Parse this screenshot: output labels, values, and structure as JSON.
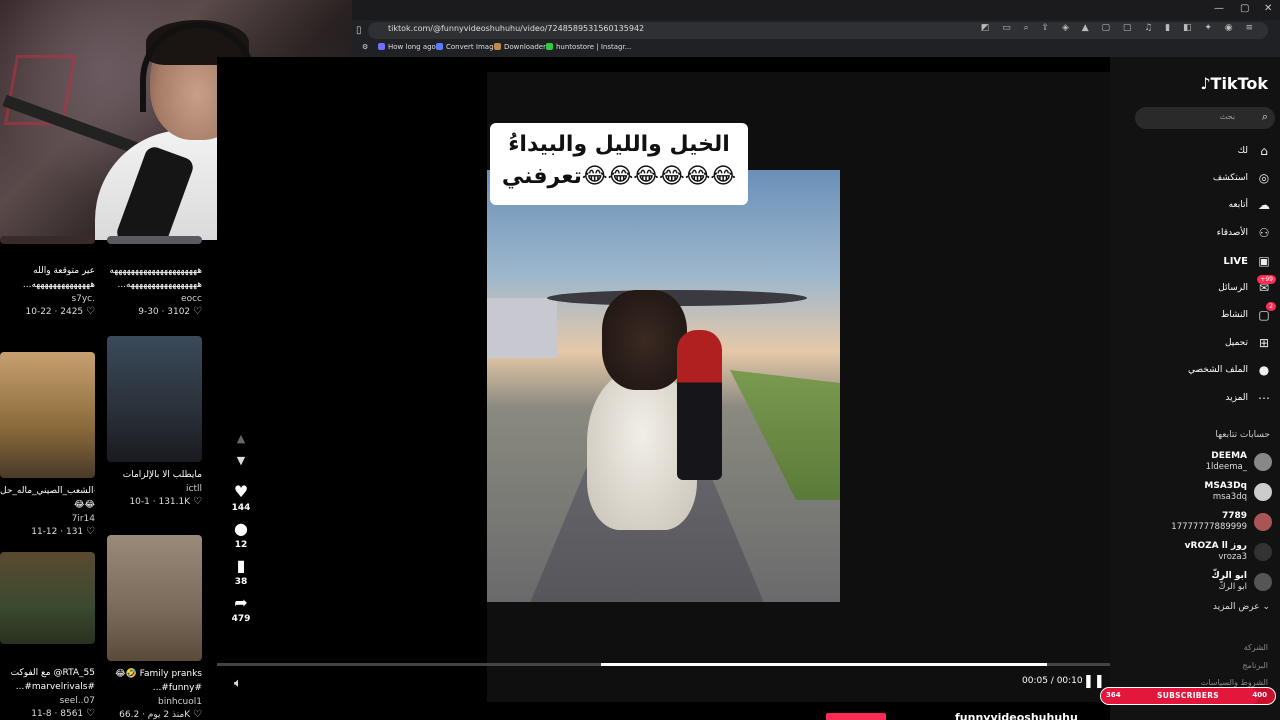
{
  "browser": {
    "url": "tiktok.com/@funnyvideoshuhuhu/video/7248589531560135942",
    "bookmarks": [
      {
        "label": "How long ago",
        "color": "#6f6fff"
      },
      {
        "label": "Convert Image",
        "color": "#5a7dff"
      },
      {
        "label": "Downloader",
        "color": "#c08a4a"
      },
      {
        "label": "huntostore | Instagr...",
        "color": "#2ecc40"
      }
    ],
    "window_controls": [
      "—",
      "▢",
      "✕"
    ]
  },
  "left_feed": {
    "cards": [
      {
        "caption": "عير متوقعة والله",
        "caption2": "...ههههههههههههههه",
        "user": "s7yc.",
        "likes": "2425",
        "date": "10-22",
        "thumb": "#3a2a2a"
      },
      {
        "caption": "هههههههههههههههههههههه",
        "caption2": "...هههههههههههههههههه",
        "user": "eocc",
        "likes": "3102",
        "date": "9-30",
        "thumb": "#5a5a60"
      },
      {
        "caption": "الشعب_الصيني_ماله_حل#",
        "caption2": "😂😂",
        "user": "7ir14",
        "likes": "131",
        "date": "11-12",
        "thumb": "#8a6a3a"
      },
      {
        "caption": "مايطلب الا بالإلزامات",
        "caption2": "",
        "user": "ictll",
        "likes": "131.1K",
        "date": "10-1",
        "thumb": "#4a5a6a"
      },
      {
        "caption": "مع الفوكت @RTA_55",
        "caption2": "...#marvelrivals#",
        "user": "seel..07",
        "likes": "8561",
        "date": "11-8",
        "thumb": "#3a4a30"
      },
      {
        "caption": "😂🤣 Family pranks",
        "caption2": "...#funny#",
        "user": "binhcuol1",
        "likes": "66.2K",
        "date": "منذ 2 يوم",
        "thumb": "#7a6a5a"
      }
    ]
  },
  "video": {
    "caption_line1": "الخيل والليل والبيداءُ",
    "caption_line2": "تعرفني😂😂😂😂😂😂",
    "likes": "144",
    "comments": "12",
    "saves": "38",
    "shares": "479",
    "time": "00:05 / 00:10",
    "progress": 0.5,
    "author": "funnyvideoshuhuhu"
  },
  "sidebar": {
    "logo": "TikTok",
    "search_placeholder": "بحث",
    "nav": [
      {
        "label": "لك",
        "icon": "⌂",
        "name": "home"
      },
      {
        "label": "استكشف",
        "icon": "◎",
        "name": "explore"
      },
      {
        "label": "أتابعه",
        "icon": "☁",
        "name": "following"
      },
      {
        "label": "الأصدقاء",
        "icon": "⚇",
        "name": "friends"
      },
      {
        "label": "LIVE",
        "icon": "▣",
        "name": "live"
      },
      {
        "label": "الرسائل",
        "icon": "✉",
        "name": "messages",
        "badge": "+99"
      },
      {
        "label": "النشاط",
        "icon": "▢",
        "name": "activity",
        "badge": "2"
      },
      {
        "label": "تحميل",
        "icon": "⊞",
        "name": "upload"
      },
      {
        "label": "الملف الشخصي",
        "icon": "●",
        "name": "profile"
      },
      {
        "label": "المزيد",
        "icon": "⋯",
        "name": "more"
      }
    ],
    "following_title": "حسابات تتابعها",
    "accounts": [
      {
        "name": "DEEMA",
        "handle": "1ldeema_",
        "color": "#888"
      },
      {
        "name": "MSA3Dq",
        "handle": "msa3dq",
        "color": "#ccc"
      },
      {
        "name": "7789",
        "handle": "17777777889999",
        "color": "#a55"
      },
      {
        "name": "vROZA ll روز",
        "handle": "vroza3",
        "color": "#333"
      },
      {
        "name": "ابو الركّ",
        "handle": "ابو الركّ",
        "color": "#555"
      }
    ],
    "see_more": "عرض المزيد",
    "footer": [
      "الشركة",
      "البرنامج",
      "الشروط والسياسات"
    ]
  },
  "subscribers": {
    "left": "364",
    "label": "SUBSCRIBERS",
    "right": "400",
    "progress": 0.91
  }
}
